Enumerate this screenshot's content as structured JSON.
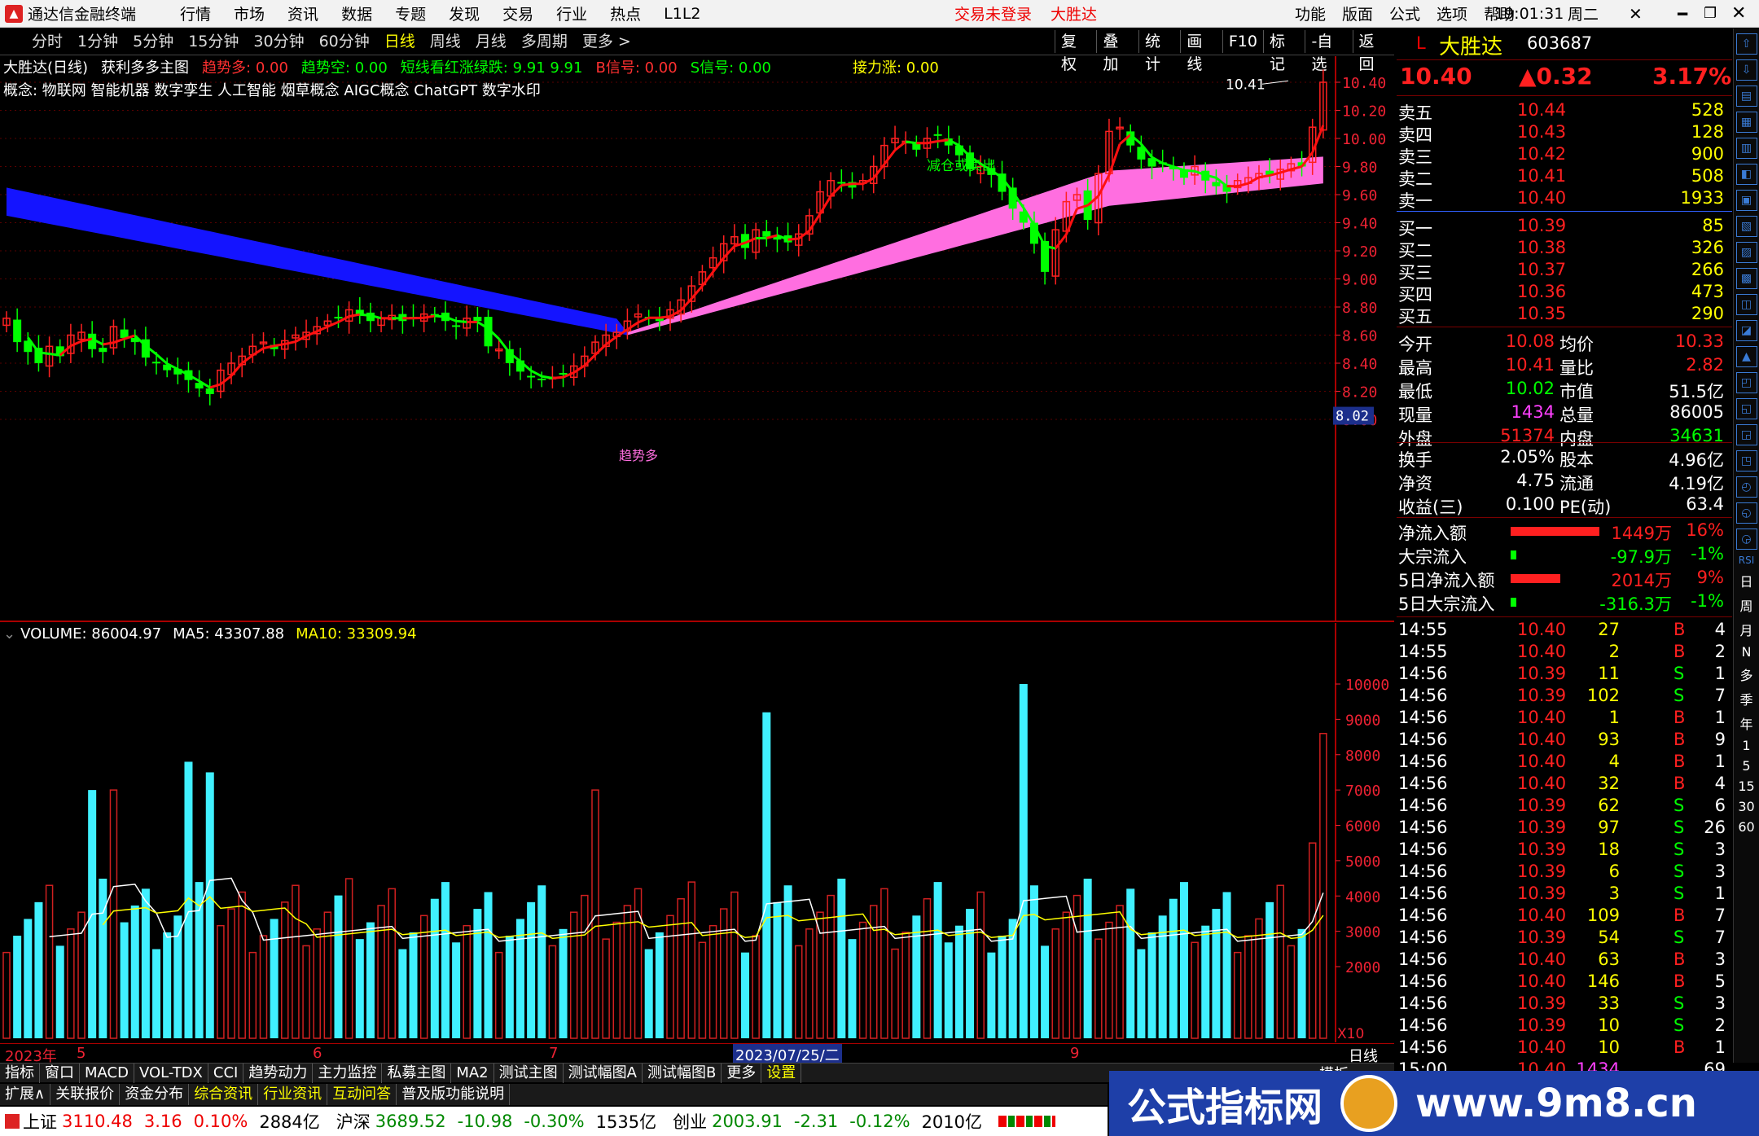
{
  "app": {
    "title": "通达信金融终端",
    "login": "交易未登录",
    "stock_name": "大胜达",
    "time": "19:01:31",
    "weekday": "周二"
  },
  "menu": [
    "行情",
    "市场",
    "资讯",
    "数据",
    "专题",
    "发现",
    "交易",
    "行业",
    "热点",
    "L1L2"
  ],
  "right_menu": [
    "功能",
    "版面",
    "公式",
    "选项",
    "帮助"
  ],
  "periods": [
    "分时",
    "1分钟",
    "5分钟",
    "15分钟",
    "30分钟",
    "60分钟",
    "日线",
    "周线",
    "月线",
    "多周期",
    "更多 >"
  ],
  "active_period": "日线",
  "toolbar": [
    "复权",
    "叠加",
    "统计",
    "画线",
    "F10",
    "标记",
    "-自选",
    "返回"
  ],
  "main": {
    "indicator_line": [
      {
        "t": "大胜达(日线)",
        "c": "#ffffff"
      },
      {
        "t": "获利多多主图",
        "c": "#ffffff"
      },
      {
        "t": "趋势多: 0.00",
        "c": "#ff3030"
      },
      {
        "t": "趋势空: 0.00",
        "c": "#00ff00"
      },
      {
        "t": "短线看红涨绿跌: 9.91  9.91",
        "c": "#00ff00"
      },
      {
        "t": "B信号: 0.00",
        "c": "#ff3030"
      },
      {
        "t": "S信号: 0.00",
        "c": "#00ff00"
      },
      {
        "t": "接力涨: 0.00",
        "c": "#ffff00"
      }
    ],
    "concept": "概念: 物联网 智能机器 数字孪生 人工智能 烟草概念 AIGC概念 ChatGPT 数字水印",
    "high_label": "10.41",
    "low_marker": "8.02",
    "annot_reduce": "减仓或卖出",
    "annot_trend": "趋势多",
    "axis": [
      "10.40",
      "10.20",
      "10.00",
      "9.80",
      "9.60",
      "9.40",
      "9.20",
      "9.00",
      "8.80",
      "8.60",
      "8.40",
      "8.20",
      "8.00"
    ]
  },
  "volume": {
    "label": "VOLUME: 86004.97",
    "ma5": "MA5: 43307.88",
    "ma10": "MA10: 33309.94",
    "axis": [
      "10000",
      "9000",
      "8000",
      "7000",
      "6000",
      "5000",
      "4000",
      "3000",
      "2000"
    ],
    "unit": "X10"
  },
  "date_axis": {
    "year": "2023年",
    "m5": "5",
    "m6": "6",
    "m7": "7",
    "date": "2023/07/25/二",
    "m9": "9",
    "period": "日线"
  },
  "quote": {
    "code": "603687",
    "name": "大胜达",
    "flag": "L",
    "price": "10.40",
    "change": "▲0.32",
    "pct": "3.17%",
    "asks": [
      [
        "卖五",
        "10.44",
        "528"
      ],
      [
        "卖四",
        "10.43",
        "128"
      ],
      [
        "卖三",
        "10.42",
        "900"
      ],
      [
        "卖二",
        "10.41",
        "508"
      ],
      [
        "卖一",
        "10.40",
        "1933"
      ]
    ],
    "bids": [
      [
        "买一",
        "10.39",
        "85"
      ],
      [
        "买二",
        "10.38",
        "326"
      ],
      [
        "买三",
        "10.37",
        "266"
      ],
      [
        "买四",
        "10.36",
        "473"
      ],
      [
        "买五",
        "10.35",
        "290"
      ]
    ],
    "stats": [
      [
        "今开",
        "10.08",
        "均价",
        "10.33"
      ],
      [
        "最高",
        "10.41",
        "量比",
        "2.82"
      ],
      [
        "最低",
        "10.02",
        "市值",
        "51.5亿"
      ],
      [
        "现量",
        "1434",
        "总量",
        "86005"
      ],
      [
        "外盘",
        "51374",
        "内盘",
        "34631"
      ]
    ],
    "fin": [
      [
        "换手",
        "2.05%",
        "股本",
        "4.96亿"
      ],
      [
        "净资",
        "4.75",
        "流通",
        "4.19亿"
      ],
      [
        "收益(三)",
        "0.100",
        "PE(动)",
        "63.4"
      ]
    ],
    "flow": [
      {
        "label": "净流入额",
        "value": "1449万",
        "pct": "16%",
        "level": 0.16,
        "color": "#ff2020"
      },
      {
        "label": "大宗流入",
        "value": "-97.9万",
        "pct": "-1%",
        "level": 0.01,
        "color": "#00ff00"
      },
      {
        "label": "5日净流入额",
        "value": "2014万",
        "pct": "9%",
        "level": 0.09,
        "color": "#ff2020"
      },
      {
        "label": "5日大宗流入",
        "value": "-316.3万",
        "pct": "-1%",
        "level": 0.01,
        "color": "#00ff00"
      }
    ],
    "ticks": [
      [
        "14:55",
        "10.40",
        "27",
        "B",
        "4"
      ],
      [
        "14:55",
        "10.40",
        "2",
        "B",
        "2"
      ],
      [
        "14:56",
        "10.39",
        "11",
        "S",
        "1"
      ],
      [
        "14:56",
        "10.39",
        "102",
        "S",
        "7"
      ],
      [
        "14:56",
        "10.40",
        "1",
        "B",
        "1"
      ],
      [
        "14:56",
        "10.40",
        "93",
        "B",
        "9"
      ],
      [
        "14:56",
        "10.40",
        "4",
        "B",
        "1"
      ],
      [
        "14:56",
        "10.40",
        "32",
        "B",
        "4"
      ],
      [
        "14:56",
        "10.39",
        "62",
        "S",
        "6"
      ],
      [
        "14:56",
        "10.39",
        "97",
        "S",
        "26"
      ],
      [
        "14:56",
        "10.39",
        "18",
        "S",
        "3"
      ],
      [
        "14:56",
        "10.39",
        "6",
        "S",
        "3"
      ],
      [
        "14:56",
        "10.39",
        "3",
        "S",
        "1"
      ],
      [
        "14:56",
        "10.40",
        "109",
        "B",
        "7"
      ],
      [
        "14:56",
        "10.39",
        "54",
        "S",
        "7"
      ],
      [
        "14:56",
        "10.40",
        "63",
        "B",
        "3"
      ],
      [
        "14:56",
        "10.40",
        "146",
        "B",
        "5"
      ],
      [
        "14:56",
        "10.39",
        "33",
        "S",
        "3"
      ],
      [
        "14:56",
        "10.39",
        "10",
        "S",
        "2"
      ],
      [
        "14:56",
        "10.40",
        "10",
        "B",
        "1"
      ],
      [
        "15:00",
        "10.40",
        "1434",
        "",
        "69"
      ]
    ]
  },
  "tool_texts": [
    "RSI",
    "日",
    "周",
    "月",
    "N",
    "多",
    "季",
    "年",
    "1",
    "5",
    "15",
    "30",
    "60"
  ],
  "tabs1": [
    "指标",
    "窗口",
    "MACD",
    "VOL-TDX",
    "CCI",
    "趋势动力",
    "主力监控",
    "私募主图",
    "MA2",
    "测试主图",
    "测试幅图A",
    "测试幅图B",
    "更多",
    "设置"
  ],
  "tabs1_extra": "模板",
  "tabs2": [
    "扩展∧",
    "关联报价",
    "资金分布",
    "综合资讯",
    "行业资讯",
    "互动问答",
    "普及版功能说明"
  ],
  "status": [
    {
      "name": "上证",
      "v": "3110.48",
      "c": "3.16",
      "p": "0.10%",
      "a": "2884亿"
    },
    {
      "name": "沪深",
      "v": "3689.52",
      "c": "-10.98",
      "p": "-0.30%",
      "a": "1535亿"
    },
    {
      "name": "创业",
      "v": "2003.91",
      "c": "-2.31",
      "p": "-0.12%",
      "a": "2010亿"
    }
  ],
  "banner": {
    "left": "公式指标网",
    "right": "www.9m8.cn"
  }
}
